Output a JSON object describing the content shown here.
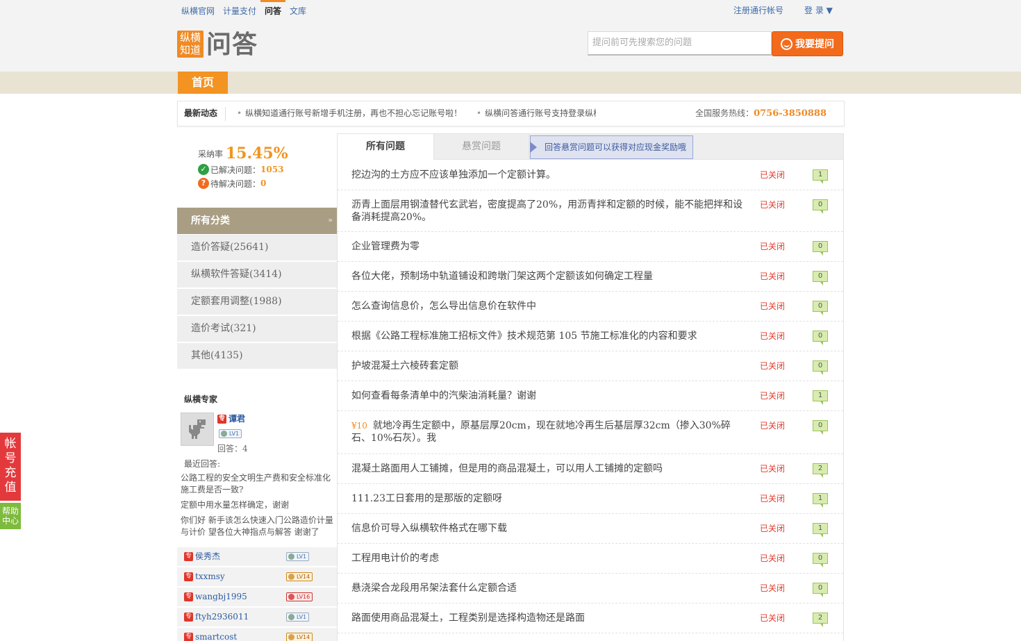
{
  "topnav": {
    "items": [
      "纵横官网",
      "计量支付",
      "问答",
      "文库"
    ],
    "active": "问答"
  },
  "account": {
    "register": "注册通行帐号",
    "login": "登 录 ▼"
  },
  "logo": {
    "box_line1": "纵横",
    "box_line2": "知道",
    "title": "问答"
  },
  "search": {
    "placeholder": "提问前可先搜索您的问题",
    "ask_button": "我要提问"
  },
  "mainnav": {
    "home": "首页"
  },
  "news": {
    "title": "最新动态",
    "items": [
      "纵横知道通行账号新增手机注册，再也不担心忘记账号啦！",
      "纵横问答通行账号支持登录纵横"
    ],
    "hotline_label": "全国服务热线：",
    "hotline_number": "0756-3850888"
  },
  "stats": {
    "rate_label": "采纳率",
    "rate_value": "15.45%",
    "solved_label": "已解决问题：",
    "solved_value": "1053",
    "pending_label": "待解决问题：",
    "pending_value": "0"
  },
  "categories": {
    "title": "所有分类",
    "arrow": "»",
    "items": [
      "造价答疑(25641)",
      "纵横软件答疑(3414)",
      "定额套用调整(1988)",
      "造价考试(321)",
      "其他(4135)"
    ]
  },
  "experts": {
    "title": "纵横专家",
    "featured": {
      "badge": "专",
      "name": "谭君",
      "level": "LV1",
      "answers": "回答：4",
      "recent_label": "最近回答:",
      "recent": [
        "公路工程的安全文明生产费和安全标准化施工费是否一致?",
        "定额中用水量怎样确定，谢谢",
        "你们好 新手该怎么快速入门公路造价计量与计价 望各位大神指点与解答 谢谢了"
      ]
    },
    "list": [
      {
        "badge": "专",
        "name": "侯秀杰",
        "level": "LV1"
      },
      {
        "badge": "专",
        "name": "txxmsy",
        "level": "LV14"
      },
      {
        "badge": "专",
        "name": "wangbj1995",
        "level": "LV16"
      },
      {
        "badge": "专",
        "name": "ftyh2936011",
        "level": "LV1"
      },
      {
        "badge": "专",
        "name": "smartcost",
        "level": "LV14"
      }
    ]
  },
  "tabs": {
    "all": "所有问题",
    "reward": "悬赏问题",
    "tip": "回答悬赏问题可以获得对应现金奖励哦"
  },
  "questions": [
    {
      "reward": "",
      "title": "挖边沟的土方应不应该单独添加一个定额计算。",
      "status": "已关闭",
      "answers": "1"
    },
    {
      "reward": "",
      "title": "沥青上面层用钢渣替代玄武岩，密度提高了20%，用沥青拌和定额的时候，能不能把拌和设备消耗提高20%。",
      "status": "已关闭",
      "answers": "0"
    },
    {
      "reward": "",
      "title": "企业管理费为零",
      "status": "已关闭",
      "answers": "0"
    },
    {
      "reward": "",
      "title": "各位大佬，预制场中轨道铺设和跨墩门架这两个定额该如何确定工程量",
      "status": "已关闭",
      "answers": "0"
    },
    {
      "reward": "",
      "title": "怎么查询信息价，怎么导出信息价在软件中",
      "status": "已关闭",
      "answers": "0"
    },
    {
      "reward": "",
      "title": "根据《公路工程标准施工招标文件》技术规范第 105 节施工标准化的内容和要求",
      "status": "已关闭",
      "answers": "0"
    },
    {
      "reward": "",
      "title": "护坡混凝土六棱砖套定额",
      "status": "已关闭",
      "answers": "0"
    },
    {
      "reward": "",
      "title": "如何查看每条清单中的汽柴油消耗量？谢谢",
      "status": "已关闭",
      "answers": "1"
    },
    {
      "reward": "¥10",
      "title": "就地冷再生定额中，原基层厚20cm，现在就地冷再生后基层厚32cm（掺入30%碎石、10%石灰）。我",
      "status": "已关闭",
      "answers": "0"
    },
    {
      "reward": "",
      "title": "混凝土路面用人工铺摊，但是用的商品混凝土，可以用人工铺摊的定额吗",
      "status": "已关闭",
      "answers": "2"
    },
    {
      "reward": "",
      "title": "111.23工日套用的是那版的定额呀",
      "status": "已关闭",
      "answers": "1"
    },
    {
      "reward": "",
      "title": "信息价可导入纵横软件格式在哪下载",
      "status": "已关闭",
      "answers": "1"
    },
    {
      "reward": "",
      "title": "工程用电计价的考虑",
      "status": "已关闭",
      "answers": "0"
    },
    {
      "reward": "",
      "title": "悬浇梁合龙段用吊架法套什么定额合适",
      "status": "已关闭",
      "answers": "0"
    },
    {
      "reward": "",
      "title": "路面使用商品混凝土，工程类别是选择构造物还是路面",
      "status": "已关闭",
      "answers": "2"
    }
  ],
  "float": {
    "recharge": "帐号充值",
    "help_line1": "帮助",
    "help_line2": "中心"
  }
}
